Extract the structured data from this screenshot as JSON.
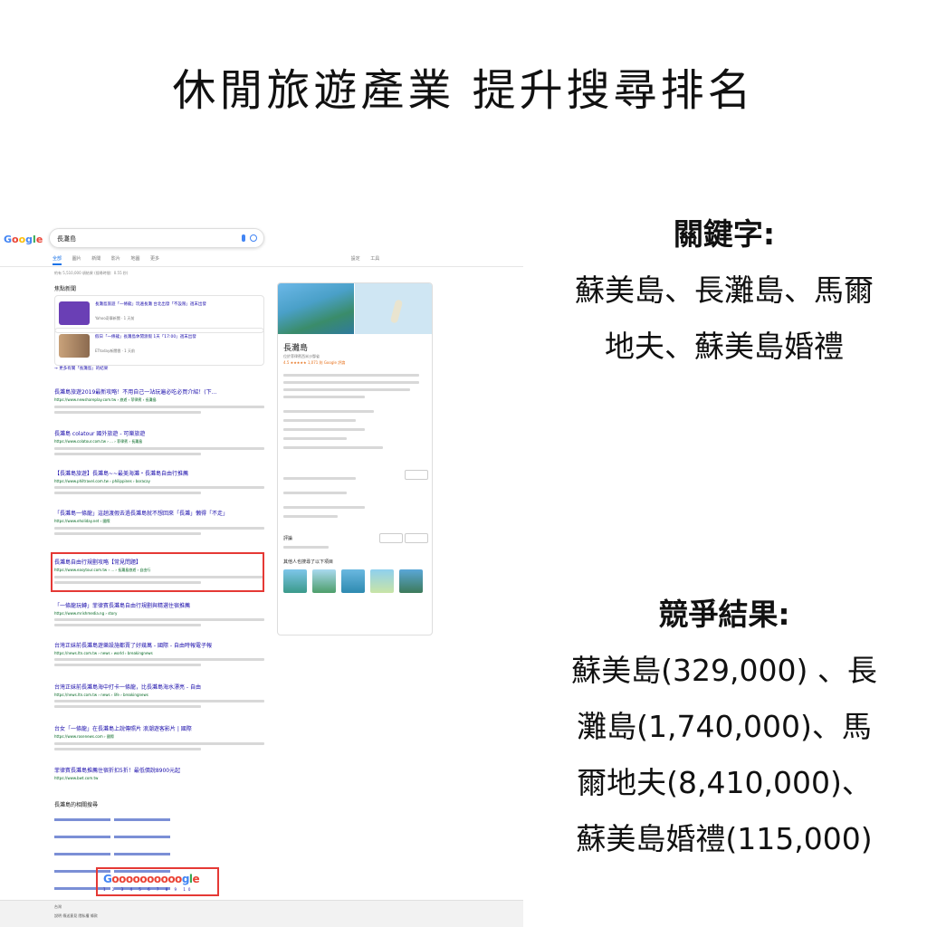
{
  "title": "休閒旅遊產業 提升搜尋排名",
  "keywords": {
    "label": "關鍵字:",
    "line1": "蘇美島、長灘島、馬爾",
    "line2": "地夫、蘇美島婚禮"
  },
  "competition": {
    "label": "競爭結果:",
    "line1": "蘇美島(329,000) 、長",
    "line2": "灘島(1,740,000)、馬",
    "line3": "爾地夫(8,410,000)、",
    "line4": "蘇美島婚禮(115,000)"
  },
  "screenshot": {
    "search_query": "長灘島",
    "tabs": [
      "全部",
      "圖片",
      "新聞",
      "影片",
      "地圖",
      "更多",
      "設定",
      "工具"
    ],
    "stats": "約有 5,510,000 項結果 (搜尋時間：0.55 秒)",
    "news_header": "焦點新聞",
    "news": [
      {
        "title": "長灘島旅遊「一條龍」玩遍長灘 台北出發「不設限」週末出發",
        "meta": "Yahoo奇摩新聞 · 1 天前"
      },
      {
        "title": "假日「一條龍」長灘島休閒渡假 1天「17:00」週末出發",
        "meta": "ETtoday新聞雲 · 1 天前"
      }
    ],
    "more_news": "→ 更多有關「長灘島」的結果",
    "results": [
      {
        "title": "長灘島旅遊2019最新攻略！不用自己一站玩遍必吃必買介紹！(下...",
        "url": "https://www.newshareplay.com.tw › 旅遊 › 菲律賓 › 長灘島"
      },
      {
        "title": "長灘島 colatour 國外旅遊 - 可樂旅遊",
        "url": "https://www.colatour.com.tw › ... › 菲律賓 › 長灘島"
      },
      {
        "title": "【長灘島旅遊】長灘島~~最美海灘・長灘島自由行推薦",
        "url": "https://www.philtravel.com.tw › philippines › boracay"
      },
      {
        "title": "「長灘島一條龍」這趟渡假去過長灘島就不想回來「長灘」懶得「不走」",
        "url": "https://www.eholiday.net › 國際"
      },
      {
        "title": "長灘島自由行規劃攻略【常見問題】",
        "url": "https://www.easytour.com.tw › ... › 長灘島旅遊 › 自由行"
      },
      {
        "title": "「一條龍玩轉」菲律賓長灘島自由行規劃與精選住宿推薦",
        "url": "https://www.mrishmedia.ng › story"
      },
      {
        "title": "台灣正妹前長灘島遊樂設施都賣了好幾萬 - 國際 - 自由時報電子報",
        "url": "https://news.ltn.com.tw › news › world › breakingnews"
      },
      {
        "title": "台灣正妹前長灘島海中打卡一條龍，比長灘島海水漂亮 - 自由",
        "url": "https://news.ltn.com.tw › news › life › breakingnews"
      },
      {
        "title": "台女「一條龍」在長灘島上說傳照片 浪潮遊客影片 | 國際",
        "url": "https://www.rosenews.com › 國際"
      },
      {
        "title": "菲律賓長灘島推薦住宿折扣5折！最低價說8900元起",
        "url": "https://www.bwt.com.tw"
      }
    ],
    "related_header": "長灘島的相關搜尋",
    "pager_numbers": "1 2 3 4 5 6 7 8 9 10",
    "footer_region": "台灣",
    "footer_links": "說明 傳送意見 隱私權 條款",
    "kp_title": "長灘島",
    "kp_subtitle": "位於菲律賓西米沙鄢省",
    "kp_rating": "4.5 ★★★★★ 1,071 則 Google 評論",
    "kp_reviews_header": "評論",
    "kp_people_also": "其他人也搜尋了以下項目",
    "colors": {
      "accent_red": "#e53935",
      "link_blue": "#1a0dab",
      "url_green": "#006621"
    }
  }
}
